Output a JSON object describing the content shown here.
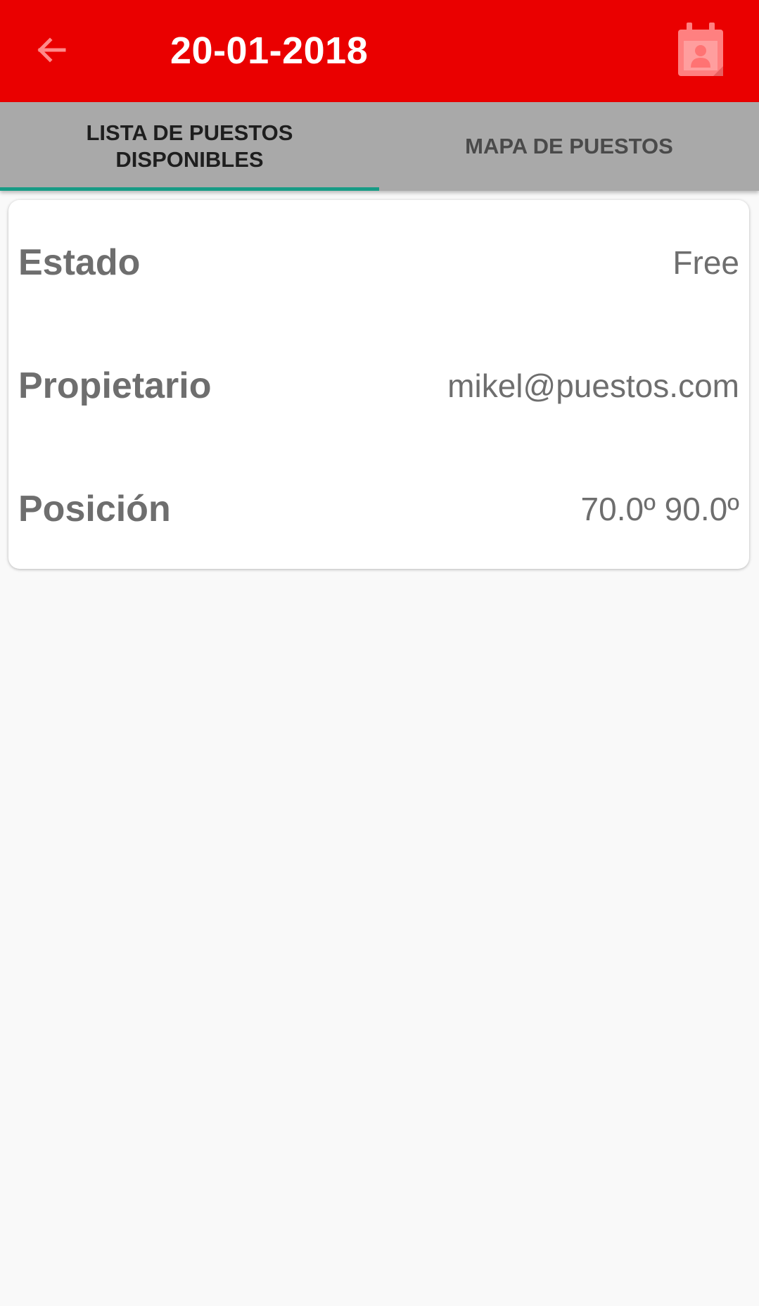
{
  "header": {
    "title": "20-01-2018",
    "back_icon": "arrow-back-icon",
    "action_icon": "calendar-person-icon",
    "background_color": "#ea0000"
  },
  "tabs": [
    {
      "label": "LISTA DE PUESTOS DISPONIBLES",
      "selected": true
    },
    {
      "label": "MAPA DE PUESTOS",
      "selected": false
    }
  ],
  "tab_indicator_color": "#179b85",
  "card": {
    "rows": [
      {
        "label": "Estado",
        "value": "Free"
      },
      {
        "label": "Propietario",
        "value": "mikel@puestos.com"
      },
      {
        "label": "Posición",
        "value": "70.0º 90.0º"
      }
    ]
  }
}
